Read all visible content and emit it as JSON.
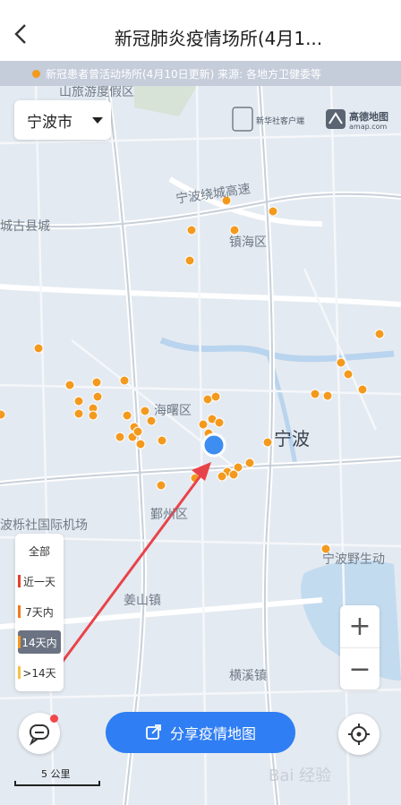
{
  "header": {
    "title": "新冠肺炎疫情场所(4月1..."
  },
  "notice": {
    "text": "新冠患者曾活动场所(4月10日更新) 来源: 各地方卫健委等"
  },
  "city_select": {
    "value": "宁波市"
  },
  "logos": {
    "xinhua": "新华社客户端",
    "amap": "高德地图",
    "amap_url": "amap.com"
  },
  "map_labels": {
    "shanzhong": "山旅游度假区",
    "ring": "宁波绕城高速",
    "zhenhai": "镇海区",
    "cixi": "城古县城",
    "haishu": "海曙区",
    "ningbo": "宁波",
    "yinzhou": "鄞州区",
    "airport": "波栎社国际机场",
    "jiangshan": "姜山镇",
    "wildlife": "宁波野生动",
    "hengxi": "横溪镇"
  },
  "filters": [
    {
      "label": "全部",
      "color": "",
      "active": false
    },
    {
      "label": "近一天",
      "color": "#e4412c",
      "active": false
    },
    {
      "label": "7天内",
      "color": "#f07a22",
      "active": false
    },
    {
      "label": "14天内",
      "color": "#f39a1e",
      "active": true
    },
    {
      "label": ">14天",
      "color": "#f6c04a",
      "active": false
    }
  ],
  "zoom": {
    "in": "+",
    "out": "−"
  },
  "share_button": {
    "label": "分享疫情地图"
  },
  "scale": {
    "label": "5 公里"
  },
  "watermark": {
    "text": "Bai 经验"
  },
  "colors": {
    "marker": "#f39a1e",
    "location": "#3d8ef0",
    "arrow": "#e8434a",
    "accent": "#2f7ef3"
  }
}
